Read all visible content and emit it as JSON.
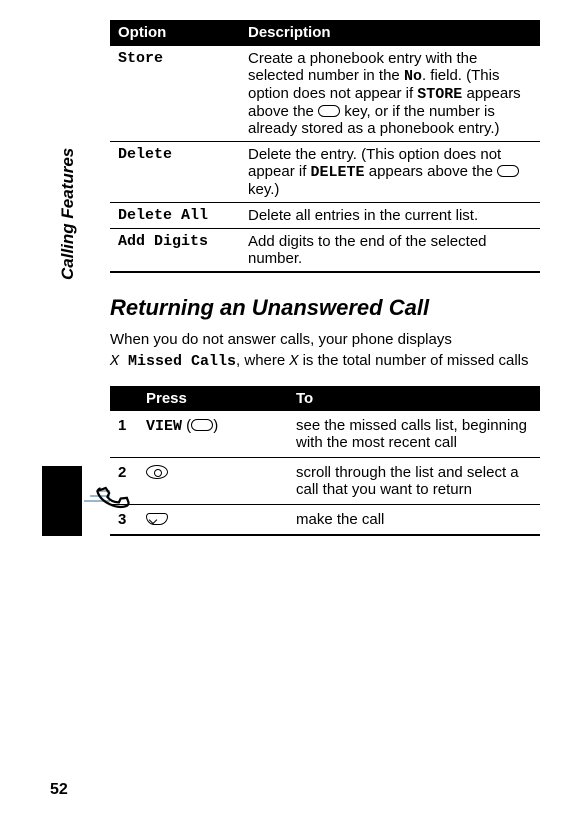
{
  "sideLabel": "Calling Features",
  "pageNumber": "52",
  "optionsTable": {
    "headers": {
      "option": "Option",
      "description": "Description"
    },
    "rows": {
      "store": {
        "name": "Store",
        "desc_before": "Create a phonebook entry with the selected number in the ",
        "no_field": "No",
        "desc_after_no": ". field. (This option does not appear if ",
        "store_word": "STORE",
        "desc_after_store": " appears above the ",
        "desc_tail": " key, or if the number is already stored as a phonebook entry.)"
      },
      "delete": {
        "name": "Delete",
        "desc_before": "Delete the entry. (This option does not appear if ",
        "delete_word": "DELETE",
        "desc_mid": " appears above the ",
        "desc_tail": " key.)"
      },
      "deleteAll": {
        "name": "Delete All",
        "desc": "Delete all entries in the current list."
      },
      "addDigits": {
        "name": "Add Digits",
        "desc": "Add digits to the end of the selected number."
      }
    }
  },
  "sectionTitle": "Returning an Unanswered Call",
  "intro": {
    "line1": "When you do not answer calls, your phone displays",
    "var": "X",
    "missed": " Missed Calls",
    "mid": ", where ",
    "var2": "X",
    "tail": " is the total number of missed calls"
  },
  "stepsTable": {
    "headers": {
      "press": "Press",
      "to": "To"
    },
    "rows": {
      "r1": {
        "num": "1",
        "press_label": "VIEW",
        "press_paren_open": " (",
        "press_paren_close": ")",
        "to": "see the missed calls list, beginning with the most recent call"
      },
      "r2": {
        "num": "2",
        "to": "scroll through the list and select a call that you want to return"
      },
      "r3": {
        "num": "3",
        "to": "make the call"
      }
    }
  }
}
